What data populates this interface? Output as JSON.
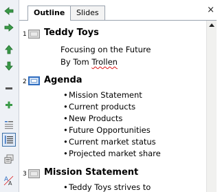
{
  "tabs": {
    "outline": "Outline",
    "slides": "Slides",
    "close": "×"
  },
  "toolbar": {
    "items": [
      {
        "name": "promote-icon"
      },
      {
        "name": "demote-icon"
      },
      {
        "name": "move-up-icon"
      },
      {
        "name": "move-down-icon"
      },
      {
        "name": "collapse-icon"
      },
      {
        "name": "expand-icon"
      },
      {
        "name": "collapse-all-icon"
      },
      {
        "name": "expand-all-icon"
      },
      {
        "name": "summary-slide-icon"
      },
      {
        "name": "show-formatting-icon"
      }
    ],
    "active": "expand-all-icon"
  },
  "outline": {
    "slides": [
      {
        "number": "1",
        "title": "Teddy Toys",
        "lines": [
          "Focusing on the Future"
        ],
        "author_prefix": "By Tom ",
        "author_name": "Trollen"
      },
      {
        "number": "2",
        "title": "Agenda",
        "bullets": [
          "Mission Statement",
          "Current products",
          "New Products",
          "Future Opportunities",
          "Current market status",
          "Projected market share"
        ]
      },
      {
        "number": "3",
        "title": "Mission Statement",
        "bullets": [
          "Teddy Toys strives to"
        ]
      }
    ]
  },
  "colors": {
    "selection": "#2f6dbf",
    "spellcheck": "#dd1111",
    "toolbar_bg": "#eef1f6"
  }
}
